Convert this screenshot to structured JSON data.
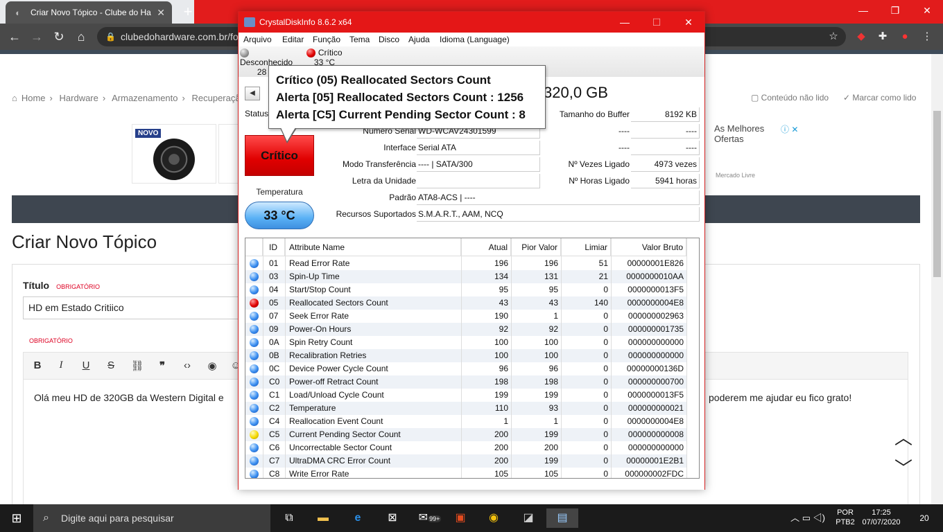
{
  "browser": {
    "tab_title": "Criar Novo Tópico - Clube do Ha",
    "tab_close": "✕",
    "new_tab": "+",
    "url": "clubedohardware.com.br/fo"
  },
  "site": {
    "breadcrumb": [
      "Home",
      "Hardware",
      "Armazenamento",
      "Recuperaçã"
    ],
    "unread": "Conteúdo não lido",
    "mark_read": "Marcar como lido",
    "ad_badge": "NOVO",
    "ad_right_title": "As Melhores Ofertas",
    "ad_right_small": "Mercado Livre",
    "page_title": "Criar Novo Tópico",
    "title_label": "Título",
    "required": "OBRIGATÓRIO",
    "title_value": "HD em Estado Critiico",
    "body_required": "OBRIGATÓRIO",
    "editor_text_left": "Olá meu HD de 320GB da Western Digital e",
    "editor_text_right": "poderem me ajudar eu fico grato!"
  },
  "cdi": {
    "title": "CrystalDiskInfo 8.6.2 x64",
    "menu": [
      "Arquivo",
      "Editar",
      "Função",
      "Tema",
      "Disco",
      "Ajuda",
      "Idioma (Language)"
    ],
    "disks": [
      {
        "status": "Desconhecido",
        "temp": "28 °C",
        "letter": "C"
      },
      {
        "status": "Crítico",
        "temp": "33 °C",
        "letter": ""
      }
    ],
    "disk_size": "320,0 GB",
    "status_label": "Status",
    "status_value": "Crítico",
    "temp_label": "Temperatura",
    "temp_value": "33 °C",
    "fields": {
      "serial_label": "Número Serial",
      "serial_value": "WD-WCAV24301599",
      "interface_label": "Interface",
      "interface_value": "Serial ATA",
      "transfer_label": "Modo Transferência",
      "transfer_value": "---- | SATA/300",
      "letter_label": "Letra da Unidade",
      "letter_value": "",
      "standard_label": "Padrão",
      "standard_value": "ATA8-ACS | ----",
      "features_label": "Recursos Suportados",
      "features_value": "S.M.A.R.T., AAM, NCQ",
      "buffer_label": "Tamanho do Buffer",
      "buffer_value": "8192 KB",
      "r2_label": "----",
      "r2_value": "----",
      "r3_label": "----",
      "r3_value": "----",
      "poweron_count_label": "Nº Vezes Ligado",
      "poweron_count_value": "4973 vezes",
      "poweron_hours_label": "Nº Horas Ligado",
      "poweron_hours_value": "5941 horas"
    },
    "tooltip": [
      "Crítico (05) Reallocated Sectors Count",
      "Alerta [05] Reallocated Sectors Count : 1256",
      "Alerta [C5] Current Pending Sector Count : 8"
    ],
    "table_headers": [
      "ID",
      "Attribute Name",
      "Atual",
      "Pior Valor",
      "Limiar",
      "Valor Bruto"
    ],
    "rows": [
      {
        "dot": "blue",
        "id": "01",
        "name": "Read Error Rate",
        "cur": "196",
        "worst": "196",
        "thr": "51",
        "raw": "00000001E826"
      },
      {
        "dot": "blue",
        "id": "03",
        "name": "Spin-Up Time",
        "cur": "134",
        "worst": "131",
        "thr": "21",
        "raw": "0000000010AA"
      },
      {
        "dot": "blue",
        "id": "04",
        "name": "Start/Stop Count",
        "cur": "95",
        "worst": "95",
        "thr": "0",
        "raw": "0000000013F5"
      },
      {
        "dot": "red",
        "id": "05",
        "name": "Reallocated Sectors Count",
        "cur": "43",
        "worst": "43",
        "thr": "140",
        "raw": "0000000004E8"
      },
      {
        "dot": "blue",
        "id": "07",
        "name": "Seek Error Rate",
        "cur": "190",
        "worst": "1",
        "thr": "0",
        "raw": "000000002963"
      },
      {
        "dot": "blue",
        "id": "09",
        "name": "Power-On Hours",
        "cur": "92",
        "worst": "92",
        "thr": "0",
        "raw": "000000001735"
      },
      {
        "dot": "blue",
        "id": "0A",
        "name": "Spin Retry Count",
        "cur": "100",
        "worst": "100",
        "thr": "0",
        "raw": "000000000000"
      },
      {
        "dot": "blue",
        "id": "0B",
        "name": "Recalibration Retries",
        "cur": "100",
        "worst": "100",
        "thr": "0",
        "raw": "000000000000"
      },
      {
        "dot": "blue",
        "id": "0C",
        "name": "Device Power Cycle Count",
        "cur": "96",
        "worst": "96",
        "thr": "0",
        "raw": "00000000136D"
      },
      {
        "dot": "blue",
        "id": "C0",
        "name": "Power-off Retract Count",
        "cur": "198",
        "worst": "198",
        "thr": "0",
        "raw": "000000000700"
      },
      {
        "dot": "blue",
        "id": "C1",
        "name": "Load/Unload Cycle Count",
        "cur": "199",
        "worst": "199",
        "thr": "0",
        "raw": "0000000013F5"
      },
      {
        "dot": "blue",
        "id": "C2",
        "name": "Temperature",
        "cur": "110",
        "worst": "93",
        "thr": "0",
        "raw": "000000000021"
      },
      {
        "dot": "blue",
        "id": "C4",
        "name": "Reallocation Event Count",
        "cur": "1",
        "worst": "1",
        "thr": "0",
        "raw": "0000000004E8"
      },
      {
        "dot": "yellow",
        "id": "C5",
        "name": "Current Pending Sector Count",
        "cur": "200",
        "worst": "199",
        "thr": "0",
        "raw": "000000000008"
      },
      {
        "dot": "blue",
        "id": "C6",
        "name": "Uncorrectable Sector Count",
        "cur": "200",
        "worst": "200",
        "thr": "0",
        "raw": "000000000000"
      },
      {
        "dot": "blue",
        "id": "C7",
        "name": "UltraDMA CRC Error Count",
        "cur": "200",
        "worst": "199",
        "thr": "0",
        "raw": "00000001E2B1"
      },
      {
        "dot": "blue",
        "id": "C8",
        "name": "Write Error Rate",
        "cur": "105",
        "worst": "105",
        "thr": "0",
        "raw": "000000002FDC"
      }
    ]
  },
  "taskbar": {
    "search_placeholder": "Digite aqui para pesquisar",
    "badge": "99+",
    "lang": "POR",
    "kbd": "PTB2",
    "time": "17:25",
    "date": "07/07/2020",
    "notif": "20"
  }
}
